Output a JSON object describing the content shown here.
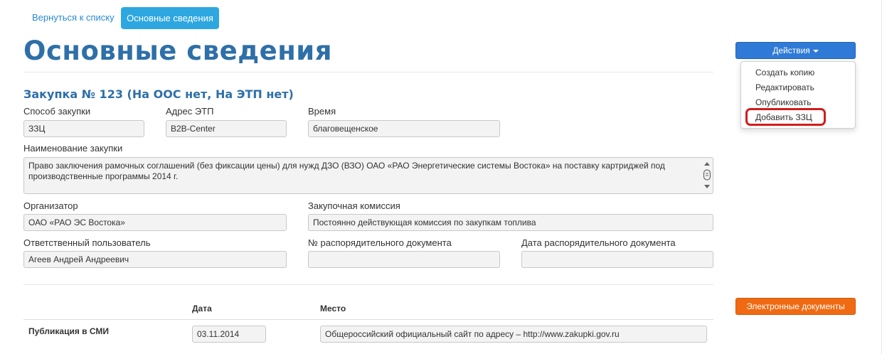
{
  "nav": {
    "back_label": "Вернуться к списку",
    "active_tab_label": "Основные сведения"
  },
  "page_title": "Основные сведения",
  "actions": {
    "button_label": "Действия",
    "menu": [
      "Создать копию",
      "Редактировать",
      "Опубликовать",
      "Добавить ЗЗЦ"
    ],
    "highlight_color": "#d11c1c"
  },
  "procurement": {
    "title": "Закупка № 123 (На ООС нет, На ЭТП нет)",
    "method_label": "Способ закупки",
    "method_value": "ЗЗЦ",
    "etp_label": "Адрес ЭТП",
    "etp_value": "B2B-Center",
    "time_label": "Время",
    "time_value": "благовещенское",
    "name_label": "Наименование закупки",
    "name_value": "Право заключения рамочных соглашений (без фиксации цены) для нужд ДЗО (ВЗО) ОАО «РАО Энергетические системы Востока» на поставку картриджей под производственные программы 2014 г.",
    "organizer_label": "Организатор",
    "organizer_value": "ОАО «РАО ЭС Востока»",
    "commission_label": "Закупочная комиссия",
    "commission_value": "Постоянно действующая комиссия по закупкам топлива",
    "responsible_label": "Ответственный пользователь",
    "responsible_value": "Агеев Андрей Андреевич",
    "order_no_label": "№ распорядительного документа",
    "order_no_value": "",
    "order_date_label": "Дата распорядительного документа",
    "order_date_value": ""
  },
  "edocs_button_label": "Электронные документы",
  "publication_table": {
    "headers": [
      "",
      "Дата",
      "Место"
    ],
    "rows": [
      {
        "label": "Публикация в СМИ",
        "date": "03.11.2014",
        "place": "Общероссийский официальный сайт по адресу – http://www.zakupki.gov.ru"
      }
    ]
  },
  "colors": {
    "title_blue": "#2e6fa8",
    "tab_active": "#2ea7e0",
    "actions_button": "#2f7ad6",
    "edocs_button": "#ef6a12"
  }
}
